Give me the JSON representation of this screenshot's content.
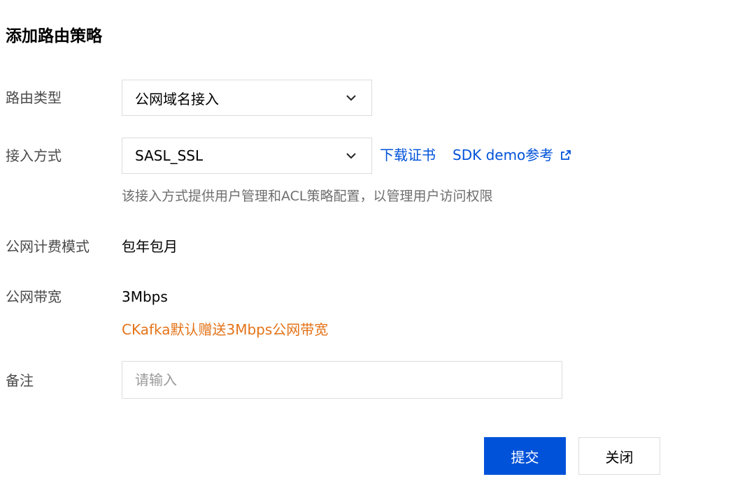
{
  "dialog": {
    "title": "添加路由策略"
  },
  "route_type": {
    "label": "路由类型",
    "value": "公网域名接入"
  },
  "access_method": {
    "label": "接入方式",
    "value": "SASL_SSL",
    "download_cert": "下载证书",
    "sdk_demo": "SDK demo参考",
    "help": "该接入方式提供用户管理和ACL策略配置，以管理用户访问权限"
  },
  "billing": {
    "label": "公网计费模式",
    "value": "包年包月"
  },
  "bandwidth": {
    "label": "公网带宽",
    "value": "3Mbps",
    "note": "CKafka默认赠送3Mbps公网带宽",
    "note_color": "#e37318"
  },
  "remark": {
    "label": "备注",
    "placeholder": "请输入"
  },
  "actions": {
    "submit": "提交",
    "close": "关闭"
  },
  "colors": {
    "primary": "#0052d9",
    "warning": "#e37318"
  },
  "icons": {
    "dropdown": "chevron-down-icon",
    "external": "external-link-icon"
  }
}
